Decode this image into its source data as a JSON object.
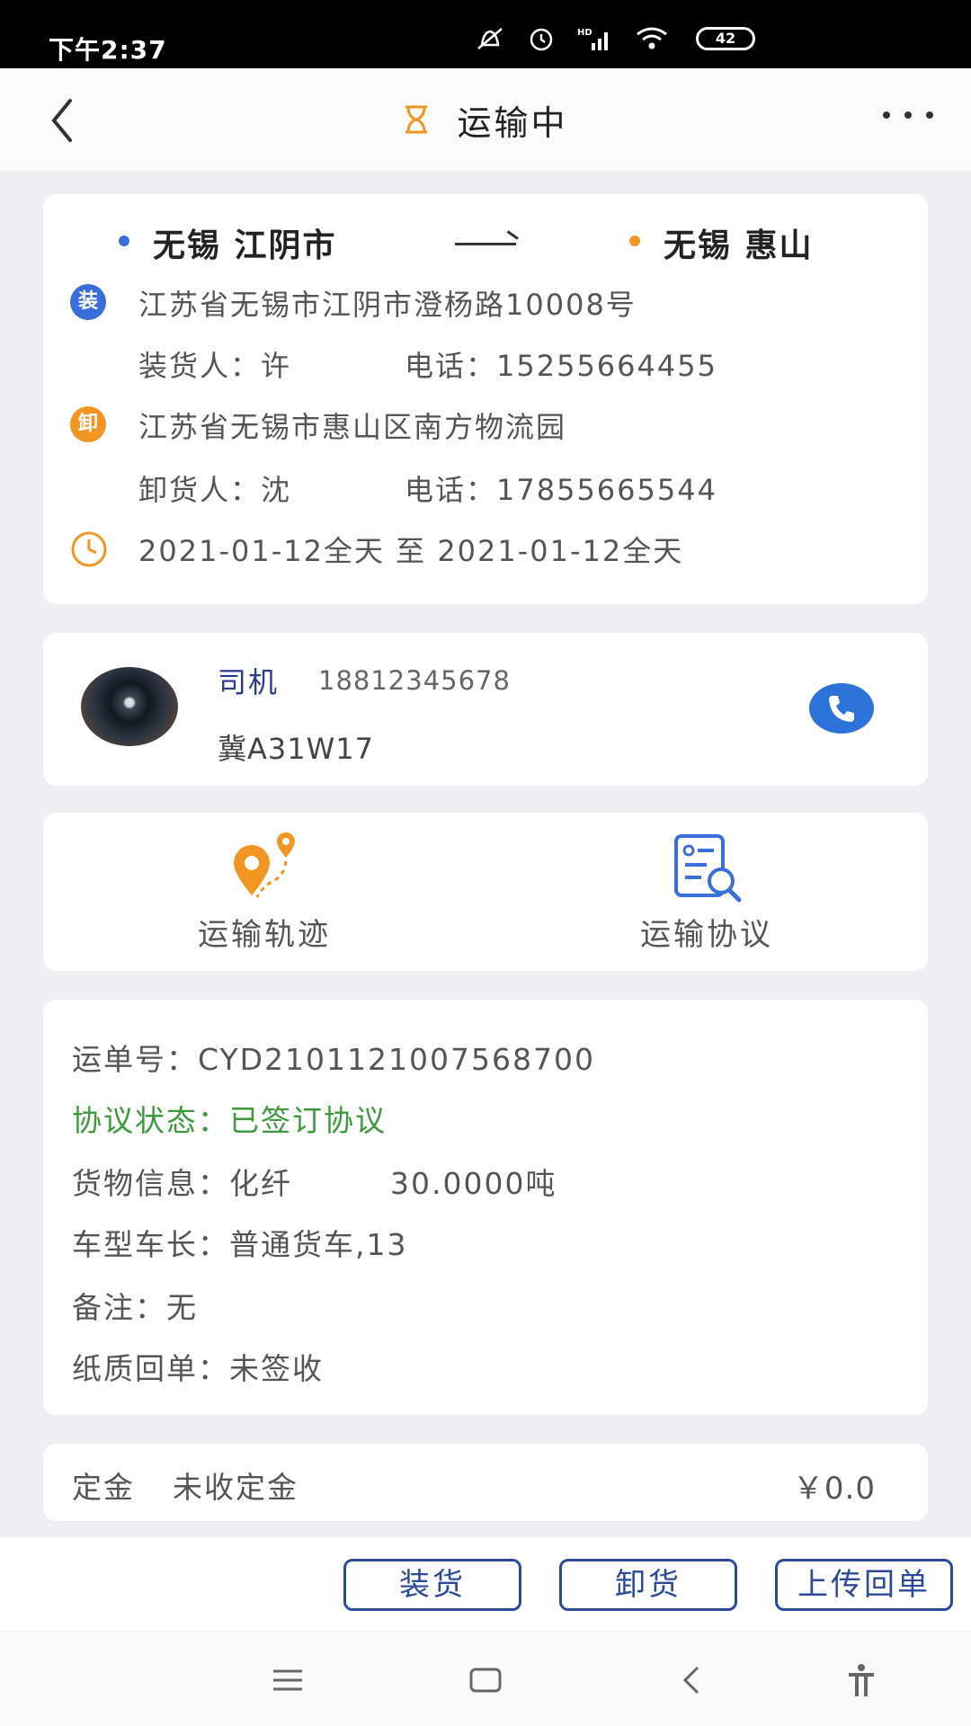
{
  "status_bar": {
    "time": "下午2:37",
    "network": "HD",
    "battery": "42"
  },
  "header": {
    "title": "运输中"
  },
  "route": {
    "from_city": "无锡 江阴市",
    "to_city": "无锡 惠山",
    "load_badge": "装",
    "load_address": "江苏省无锡市江阴市澄杨路10008号",
    "loader": "装货人：许",
    "loader_phone": "电话：15255664455",
    "unload_badge": "卸",
    "unload_address": "江苏省无锡市惠山区南方物流园",
    "unloader": "卸货人：沈",
    "unloader_phone": "电话：17855665544",
    "time_range": "2021-01-12全天 至 2021-01-12全天"
  },
  "driver": {
    "label": "司机",
    "phone": "18812345678",
    "plate": "冀A31W17"
  },
  "actions": {
    "track": "运输轨迹",
    "agreement": "运输协议"
  },
  "details": {
    "waybill": "运单号：CYD2101121007568700",
    "agreement_status": "协议状态：已签订协议",
    "cargo": "货物信息：化纤",
    "weight": "30.0000吨",
    "vehicle": "车型车长：普通货车,13",
    "remark": "备注：无",
    "receipt": "纸质回单：未签收"
  },
  "deposit": {
    "label": "定金",
    "status": "未收定金",
    "amount": "￥0.0"
  },
  "bottom_buttons": {
    "load": "装货",
    "unload": "卸货",
    "upload_receipt": "上传回单"
  },
  "colors": {
    "accent_blue": "#2c72d9",
    "accent_orange": "#f39522",
    "status_green": "#3b9a3c",
    "button_border": "#2c4a9c"
  }
}
